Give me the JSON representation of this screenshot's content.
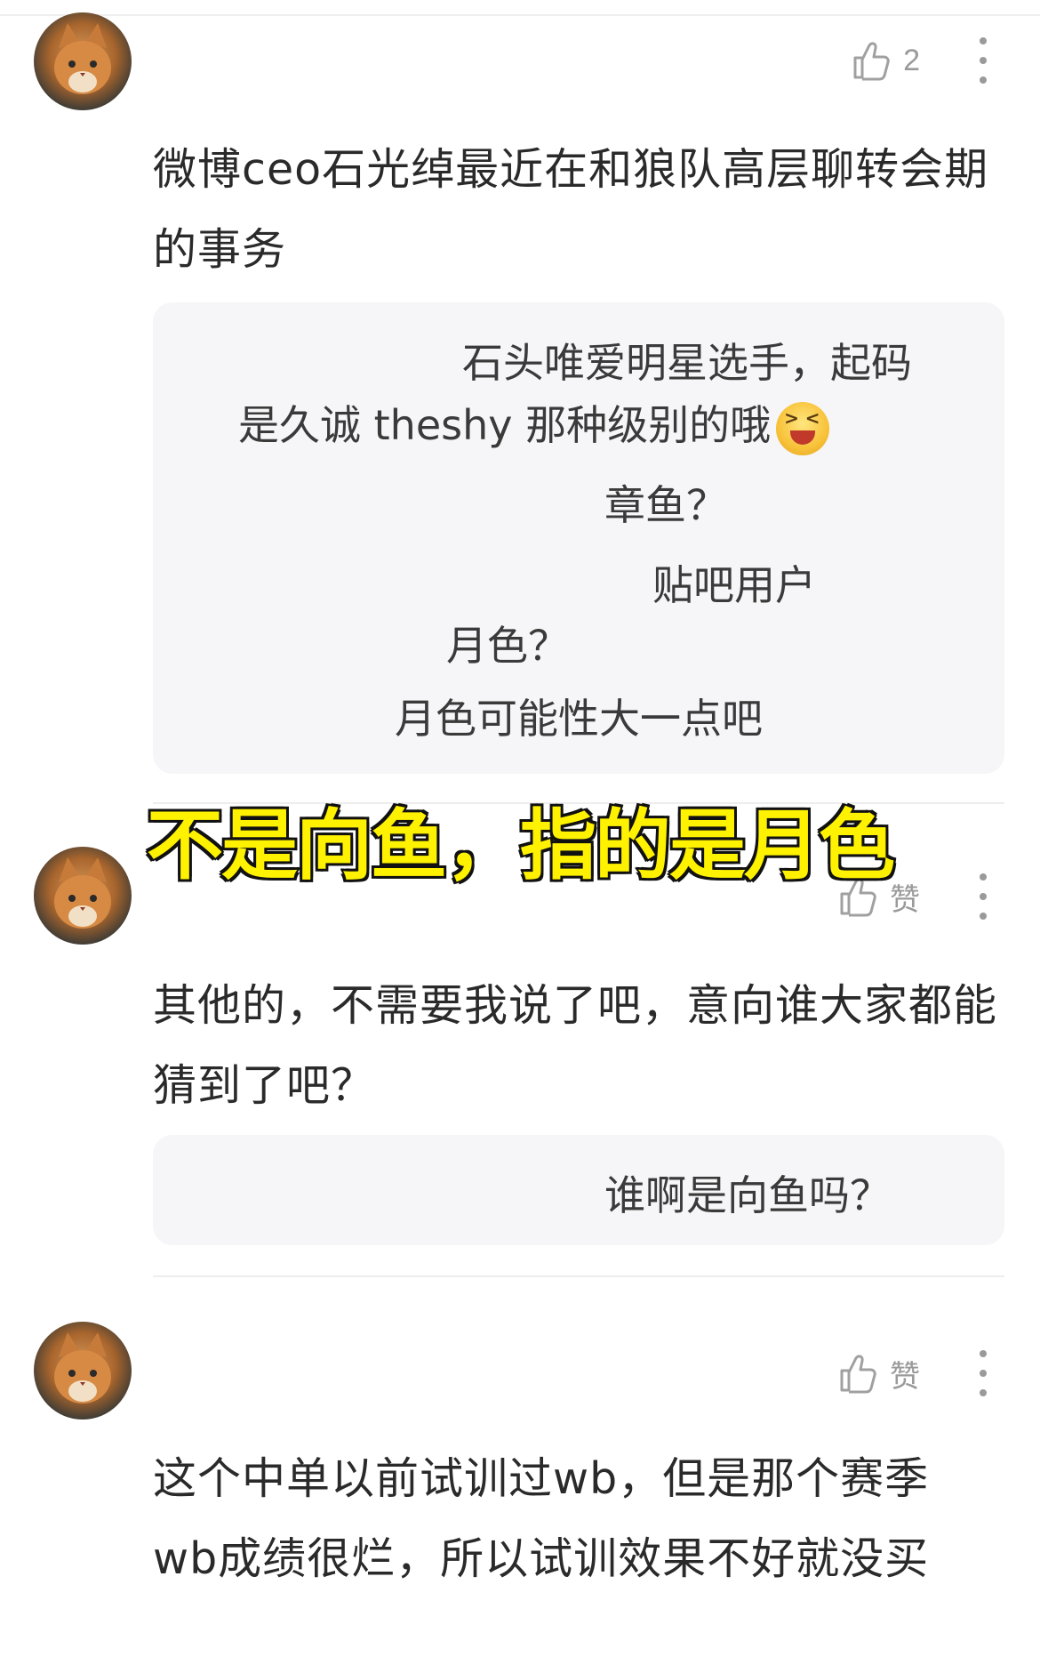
{
  "comments": [
    {
      "like_label": "2",
      "text": "微博ceo石光绰最近在和狼队高层聊转会期的事务",
      "replies": [
        "石头唯爱明星选手，起码",
        "是久诚 theshy 那种级别的哦",
        "章鱼？",
        "贴吧用户",
        "月色？",
        "月色可能性大一点吧"
      ]
    },
    {
      "like_label": "赞",
      "text": "其他的，不需要我说了吧，意向谁大家都能猜到了吧？",
      "replies": [
        "谁啊是向鱼吗？"
      ]
    },
    {
      "like_label": "赞",
      "text": "这个中单以前试训过wb，但是那个赛季wb成绩很烂，所以试训效果不好就没买",
      "replies": []
    }
  ],
  "overlay_caption": "不是向鱼，指的是月色",
  "icons": {
    "like": "thumbs-up-icon",
    "more": "more-vertical-icon",
    "avatar": "cat-avatar",
    "emoji": "laughing-emoji-icon"
  },
  "colors": {
    "caption_fill": "#fff200",
    "caption_stroke": "#111111",
    "reply_bg": "#f6f6f8",
    "meta_gray": "#9a9a9a"
  }
}
